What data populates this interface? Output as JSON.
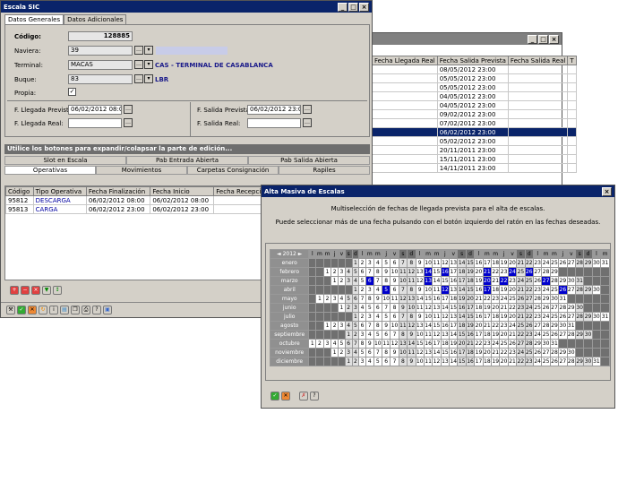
{
  "w1": {
    "title": "Escala SIC",
    "tabs": [
      "Datos Generales",
      "Datos Adicionales"
    ],
    "codigo_label": "Código:",
    "codigo": "128885",
    "naviera_label": "Naviera:",
    "naviera": "39",
    "terminal_label": "Terminal:",
    "terminal": "MACAS",
    "terminal_desc": "CAS - TERMINAL DE CASABLANCA",
    "buque_label": "Buque:",
    "buque": "83",
    "buque_desc": "LBR",
    "propia_label": "Propia:",
    "fllp_label": "F. Llegada Prevista:",
    "fllp": "06/02/2012 08:00",
    "fsp_label": "F. Salida Prevista:",
    "fsp": "06/02/2012 23:00",
    "fllr_label": "F. Llegada Real:",
    "fsr_label": "F. Salida Real:",
    "hint": "Utilice los botones para expandir/colapsar la parte de edición...",
    "subtabs": [
      "Slot en Escala",
      "Pab Entrada Abierta",
      "Pab Salida Abierta",
      "Operativas",
      "Movimientos",
      "Carpetas Consignación",
      "Rapiles"
    ],
    "cols": [
      "Código",
      "Tipo Operativa",
      "Fecha Finalización",
      "Fecha Inicio",
      "Fecha Recepción"
    ],
    "rows": [
      [
        "95812",
        "DESCARGA",
        "06/02/2012 08:00",
        "06/02/2012 08:00",
        ""
      ],
      [
        "95813",
        "CARGA",
        "06/02/2012 23:00",
        "06/02/2012 23:00",
        ""
      ]
    ]
  },
  "w2": {
    "cols": [
      "Fecha Llegada Real",
      "Fecha Salida Prevista",
      "Fecha Salida Real",
      "T"
    ],
    "dates": [
      "08/05/2012 23:00",
      "05/05/2012 23:00",
      "05/05/2012 23:00",
      "04/05/2012 23:00",
      "04/05/2012 23:00",
      "09/02/2012 23:00",
      "07/02/2012 23:00",
      "06/02/2012 23:00",
      "05/02/2012 23:00",
      "20/11/2011 23:00",
      "15/11/2011 23:00",
      "14/11/2011 23:00"
    ]
  },
  "w3": {
    "title": "Alta Masiva de Escalas",
    "line1": "Multiselección de fechas de llegada prevista para el alta de escalas.",
    "line2": "Puede seleccionar más de una fecha pulsando con el botón izquierdo del ratón en las fechas deseadas.",
    "year": "2012",
    "days": [
      "l",
      "m",
      "m",
      "j",
      "v",
      "s",
      "d",
      "l",
      "m",
      "m",
      "j",
      "v",
      "s",
      "d",
      "l",
      "m",
      "m",
      "j",
      "v",
      "s",
      "d",
      "l",
      "m",
      "m",
      "j",
      "v",
      "s",
      "d",
      "l",
      "m",
      "m",
      "j",
      "v",
      "s",
      "d",
      "l",
      "m"
    ],
    "months": [
      "enero",
      "febrero",
      "marzo",
      "abril",
      "mayo",
      "junio",
      "julio",
      "agosto",
      "septiembre",
      "octubre",
      "noviembre",
      "diciembre"
    ],
    "offsets": [
      6,
      2,
      3,
      6,
      1,
      4,
      6,
      2,
      5,
      0,
      3,
      5
    ],
    "lengths": [
      31,
      29,
      31,
      30,
      31,
      30,
      31,
      31,
      30,
      31,
      30,
      31
    ],
    "selected": {
      "1": [
        14,
        16,
        21,
        24,
        26
      ],
      "2": [
        6,
        13,
        20,
        22,
        27
      ],
      "3": [
        5,
        12,
        17,
        26
      ],
      "4": []
    }
  }
}
